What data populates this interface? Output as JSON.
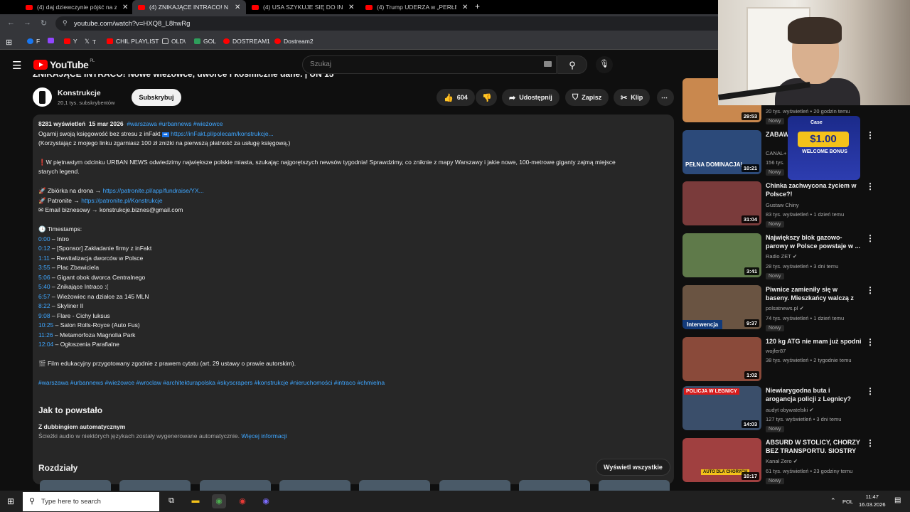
{
  "browser": {
    "tabs": [
      {
        "label": "(4) daj dziewczynie pójść na zak",
        "active": false
      },
      {
        "label": "(4) ZNIKAJĄCE INTRACO! N",
        "active": true
      },
      {
        "label": "(4) USA SZYKUJE SIĘ DO INWA",
        "active": false
      },
      {
        "label": "(4) Trump UDERZA w „PERŁĘ” I",
        "active": false
      }
    ],
    "url": "youtube.com/watch?v=HXQ8_L8hwRg",
    "bookmarks": [
      "F",
      "Y",
      "T",
      "CHIL PLAYLIST",
      "OLD\\",
      "GOL",
      "DOSTREAM1",
      "Dostream2"
    ]
  },
  "header": {
    "logo": "YouTube",
    "region": "PL",
    "search_placeholder": "Szukaj"
  },
  "video": {
    "title": "ZNIKAJĄCE INTRACO! Nowe wieżowce, dworce i kosmiczne dane. | UN 15",
    "channel": "Konstrukcje",
    "subs": "20,1 tys. subskrybentów",
    "subscribe": "Subskrybuj",
    "likes": "604",
    "share": "Udostępnij",
    "save": "Zapisz",
    "clip": "Klip"
  },
  "description": {
    "views": "8281 wyświetleń",
    "date": "15 mar 2026",
    "tags_top": "#warszawa #urbannews #wieżowce",
    "line1": "Ogarnij swoją księgowość bez stresu z inFakt",
    "line1_link": "https://inFakt.pl/polecam/konstrukcje...",
    "line2": "(Korzystając z mojego linku zgarniasz 100 zł zniżki na pierwszą płatność za usługę księgową.)",
    "para": "W piętnastym odcinku URBAN NEWS odwiedzimy największe polskie miasta, szukając najgorętszych newsów tygodnia! Sprawdzimy, co zniknie z mapy Warszawy i jakie nowe, 100-metrowe giganty zajmą miejsce",
    "para2": "starych legend.",
    "drone_label": "Zbiórka na drona →",
    "drone_link": "https://patronite.pl/app/fundraise/YX...",
    "patronite_label": "Patronite →",
    "patronite_link": "https://patronite.pl/Konstrukcje",
    "email": "Email biznesowy → konstrukcje.biznes@gmail.com",
    "timestamps_label": "Timestamps:",
    "timestamps": [
      {
        "t": "0:00",
        "text": "– Intro"
      },
      {
        "t": "0:12",
        "text": "– [Sponsor] Zakładanie firmy z inFakt"
      },
      {
        "t": "1:11",
        "text": "– Rewitalizacja dworców w Polsce"
      },
      {
        "t": "3:55",
        "text": "– Plac Zbawiciela"
      },
      {
        "t": "5:06",
        "text": "– Gigant obok dworca Centralnego"
      },
      {
        "t": "5:40",
        "text": "– Znikające Intraco :("
      },
      {
        "t": "6:57",
        "text": "– Wieżowiec na działce za 145 MLN"
      },
      {
        "t": "8:22",
        "text": "– Skyliner II"
      },
      {
        "t": "9:08",
        "text": "– Flare - Cichy luksus"
      },
      {
        "t": "10:25",
        "text": "– Salon Rolls-Royce (Auto Fus)"
      },
      {
        "t": "11:26",
        "text": "– Metamorfoza Magnolia Park"
      },
      {
        "t": "12:04",
        "text": "– Ogłoszenia Parafialne"
      }
    ],
    "film_note": "Film edukacyjny przygotowany zgodnie z prawem cytatu (art. 29 ustawy o prawie autorskim).",
    "tags_bottom": "#warszawa #urbannews #wieżowce #wroclaw #architekturapolska #skyscrapers #konstrukcje #nieruchomości #intraco #chmielna",
    "how_made": "Jak to powstało",
    "dubbing": "Z dubbingiem automatycznym",
    "dubbing_note": "Ścieżki audio w niektórych językach zostały wygenerowane automatycznie.",
    "more_info": "Więcej informacji",
    "chapters": "Rozdziały",
    "show_all": "Wyświetl wszystkie"
  },
  "recommendations": [
    {
      "title": "",
      "channel": "",
      "meta": "20 tys. wyświetleń • 20 godzin temu",
      "duration": "29:53",
      "badge": "Nowy",
      "thumb": "#c9884e"
    },
    {
      "title": "ZABAWNY TRICK",
      "channel": "CANAL+",
      "meta": "156 tys.",
      "duration": "10:21",
      "badge": "Nowy",
      "thumb": "#2c4a7a",
      "overlay": "PEŁNA DOMINACJA!"
    },
    {
      "title": "Chinka zachwycona życiem w Polsce?!",
      "channel": "Gustaw Chiny",
      "meta": "83 tys. wyświetleń • 1 dzień temu",
      "duration": "31:04",
      "badge": "Nowy",
      "thumb": "#7a3b3b"
    },
    {
      "title": "Największy blok gazowo-parowy w Polsce powstaje w ...",
      "channel": "Radio ZET",
      "meta": "28 tys. wyświetleń • 3 dni temu",
      "duration": "3:41",
      "badge": "Nowy",
      "thumb": "#5f7a4a"
    },
    {
      "title": "Piwnice zamieniły się w baseny. Mieszkańcy walczą z wodą po ...",
      "channel": "polsatnews.pl",
      "meta": "74 tys. wyświetleń • 1 dzień temu",
      "duration": "9:37",
      "badge": "Nowy",
      "thumb": "#6a5442",
      "overlay": "Interwencja"
    },
    {
      "title": "120 kg ATG nie mam już spodni",
      "channel": "wojfer87",
      "meta": "38 tys. wyświetleń • 2 tygodnie temu",
      "duration": "1:02",
      "badge": "",
      "thumb": "#8a4a3a"
    },
    {
      "title": "Niewiarygodna buta i arogancja policji z Legnicy? Mają gdzieś ...",
      "channel": "audyt obywatelski",
      "meta": "127 tys. wyświetleń • 3 dni temu",
      "duration": "14:03",
      "badge": "Nowy",
      "thumb": "#3a4e6a",
      "overlay": "POLICJA W LEGNICY"
    },
    {
      "title": "ABSURD W STOLICY, CHORZY BEZ TRANSPORTU. SIOSTRY ...",
      "channel": "Kanał Zero",
      "meta": "61 tys. wyświetleń • 23 godziny temu",
      "duration": "10:17",
      "badge": "Nowy",
      "thumb": "#a04040",
      "overlay": "AUTO DLA CHORYCH"
    }
  ],
  "promo": {
    "brand": "Case",
    "amount": "$1.00",
    "label": "WELCOME BONUS"
  },
  "taskbar": {
    "search": "Type here to search",
    "lang": "POL",
    "time": "11:47",
    "date": "16.03.2026"
  }
}
